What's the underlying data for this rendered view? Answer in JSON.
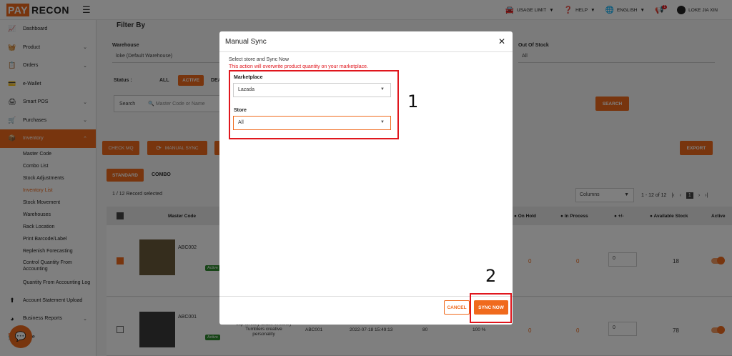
{
  "topbar": {
    "logo_pay": "PAY",
    "logo_recon": "RECON",
    "usage_limit": "USAGE LIMIT",
    "help": "HELP",
    "language": "ENGLISH",
    "notification_count": "1",
    "user": "LOKE JIA XIN"
  },
  "sidebar": {
    "items": [
      {
        "label": "Dashboard"
      },
      {
        "label": "Product"
      },
      {
        "label": "Orders"
      },
      {
        "label": "e-Wallet"
      },
      {
        "label": "Smart POS"
      },
      {
        "label": "Purchases"
      },
      {
        "label": "Inventory"
      }
    ],
    "inventory_sub": [
      "Master Code",
      "Combo List",
      "Stock Adjustments",
      "Inventory List",
      "Stock Movement",
      "Warehouses",
      "Rack Location",
      "Print Barcode/Label",
      "Replenish Forecasting",
      "Control Quantity From Accounting",
      "Quantity From Accounting Log"
    ],
    "bottom": [
      {
        "label": "Account Statement Upload"
      },
      {
        "label": "Business Reports"
      },
      {
        "label": "Store"
      }
    ]
  },
  "filter": {
    "title": "Filter By",
    "warehouse_label": "Warehouse",
    "warehouse_value": "loke (Default Warehouse)",
    "oos_label": "Out Of Stock",
    "oos_value": "All",
    "status_label": "Status :",
    "status_all": "ALL",
    "status_active": "ACTIVE",
    "status_de": "DEA",
    "search_label": "Search",
    "search_placeholder": "Master Code or Name",
    "search_button": "SEARCH"
  },
  "actions": {
    "check_mq": "CHECK MQ",
    "manual_sync": "MANUAL SYNC",
    "export": "EXPORT"
  },
  "tabs": {
    "standard": "STANDARD",
    "combo": "COMBO"
  },
  "table": {
    "record_info": "1 / 12 Record selected",
    "columns_label": "Columns",
    "pagination": "1 - 12 of 12",
    "page": "1",
    "headers": {
      "master_code": "Master Code",
      "on_hold": "On Hold",
      "in_process": "In Process",
      "plus_minus": "+/-",
      "available": "Available Stock",
      "active": "Active"
    },
    "rows": [
      {
        "code": "ABC002",
        "status": "Active",
        "on_hold": "0",
        "in_process": "0",
        "adj": "0",
        "available": "18"
      },
      {
        "code": "ABC001",
        "status": "Active",
        "name": "cup Whisky Glass Whiskey Tumblers creative personality",
        "sku": "ABC001",
        "date": "2022-07-18 15:49:13",
        "qty": "80",
        "pct": "100 %",
        "on_hold": "0",
        "in_process": "0",
        "adj": "0",
        "available": "78"
      }
    ]
  },
  "modal": {
    "title": "Manual Sync",
    "subtitle": "Select store and Sync Now",
    "warning": "This action will overwrite product quantity on your marketplace.",
    "marketplace_label": "Marketplace",
    "marketplace_value": "Lazada",
    "store_label": "Store",
    "store_value": "All",
    "cancel": "CANCEL",
    "sync_now": "SYNC NOW"
  },
  "annotations": {
    "step1": "1",
    "step2": "2"
  },
  "colors": {
    "accent": "#f06a1d",
    "highlight": "#e0161d"
  }
}
